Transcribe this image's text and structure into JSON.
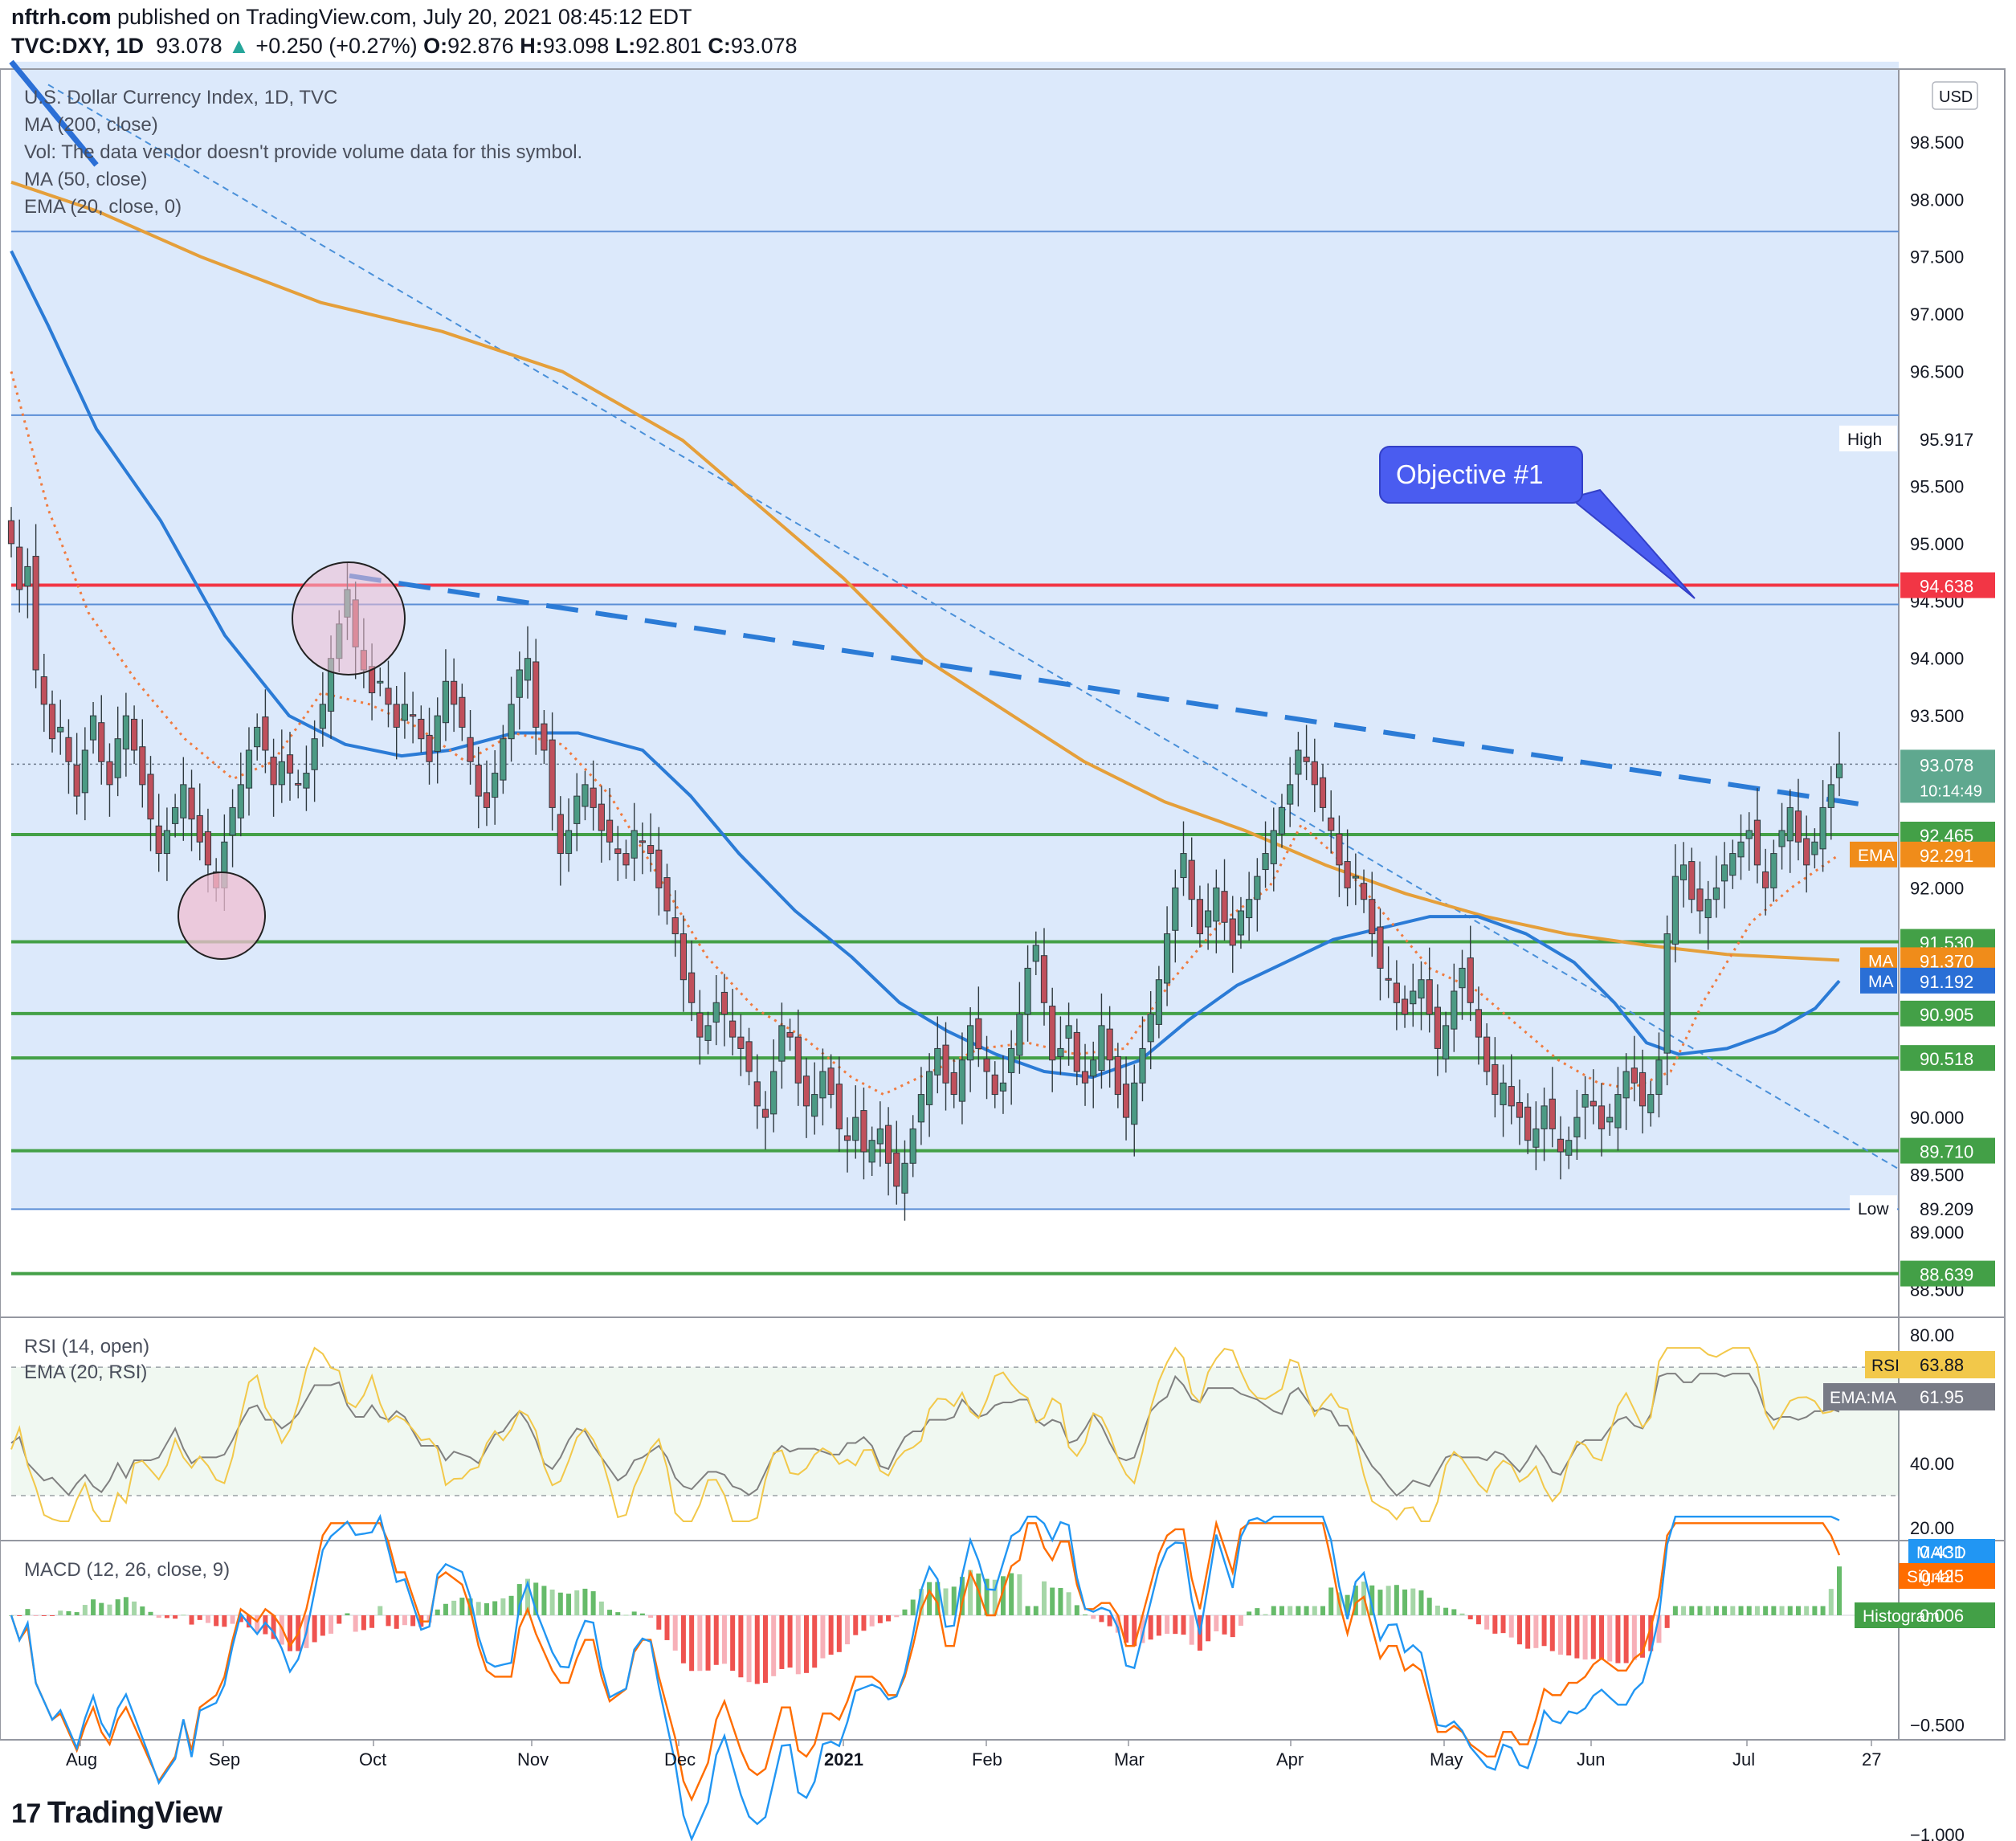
{
  "header": {
    "published_by": "nftrh.com",
    "published_rest": "published on TradingView.com, July 20, 2021 08:45:12 EDT",
    "symbol": "TVC:DXY, 1D",
    "last": "93.078",
    "change": "+0.250 (+0.27%)",
    "o_label": "O:",
    "o": "92.876",
    "h_label": "H:",
    "h": "93.098",
    "l_label": "L:",
    "l": "92.801",
    "c_label": "C:",
    "c": "93.078"
  },
  "legend": [
    "U.S. Dollar Currency Index, 1D, TVC",
    "MA (200, close)",
    "Vol: The data vendor doesn't provide volume data for this symbol.",
    "MA (50, close)",
    "EMA (20, close, 0)"
  ],
  "currency_badge": "USD",
  "annotation": "Objective #1",
  "footer": {
    "logo_mark": "17",
    "logo_text": "TradingView"
  },
  "colors": {
    "band_fill": "#dce9fb",
    "ma200": "#e59f3a",
    "ma50": "#2b7bd6",
    "ema20": "#f07b3f",
    "red_line": "#f23645",
    "green_line": "#43a047",
    "up_candle": "#4c9a84",
    "down_candle": "#c0505c",
    "rsi": "#f2c84a",
    "rsi_ema": "#808080",
    "macd": "#2196f3",
    "signal": "#ff6d00",
    "callout": "#4a5cf0"
  },
  "chart_data": [
    {
      "type": "candlestick",
      "title": "U.S. Dollar Currency Index, 1D, TVC",
      "x_ticks": [
        "Aug",
        "Sep",
        "Oct",
        "Nov",
        "Dec",
        "2021",
        "Feb",
        "Mar",
        "Apr",
        "May",
        "Jun",
        "Jul",
        "27"
      ],
      "ylim": [
        88.3,
        99.2
      ],
      "y_ticks": [
        "98.500",
        "98.000",
        "97.500",
        "97.000",
        "96.500",
        "95.500",
        "95.000",
        "94.500",
        "94.000",
        "93.500",
        "92.000",
        "90.000",
        "89.500",
        "89.000",
        "88.500"
      ],
      "closes": [
        95.0,
        94.6,
        94.8,
        93.9,
        93.6,
        93.3,
        93.4,
        93.1,
        92.8,
        93.2,
        93.5,
        93.1,
        92.9,
        93.3,
        93.5,
        93.2,
        92.9,
        92.6,
        92.3,
        92.5,
        92.7,
        92.9,
        92.6,
        92.4,
        92.2,
        92.0,
        92.4,
        92.7,
        92.9,
        93.2,
        93.4,
        93.2,
        92.9,
        93.1,
        93.0,
        92.9,
        93.0,
        93.3,
        93.6,
        94.0,
        94.3,
        94.6,
        94.1,
        93.9,
        93.7,
        93.8,
        93.6,
        93.4,
        93.6,
        93.5,
        93.3,
        93.1,
        93.5,
        93.8,
        93.6,
        93.4,
        93.1,
        92.8,
        92.7,
        93.0,
        93.3,
        93.6,
        93.9,
        94.0,
        93.4,
        93.2,
        92.7,
        92.3,
        92.5,
        92.8,
        92.9,
        92.7,
        92.5,
        92.4,
        92.3,
        92.2,
        92.5,
        92.4,
        92.3,
        92.0,
        91.8,
        91.6,
        91.2,
        91.0,
        90.7,
        90.8,
        91.0,
        90.9,
        90.7,
        90.6,
        90.4,
        90.1,
        90.0,
        90.4,
        90.8,
        90.7,
        90.3,
        90.1,
        90.2,
        90.4,
        90.2,
        89.9,
        89.8,
        90.0,
        89.7,
        89.8,
        89.9,
        89.6,
        89.4,
        89.6,
        89.9,
        90.2,
        90.4,
        90.6,
        90.3,
        90.2,
        90.5,
        90.8,
        90.6,
        90.4,
        90.2,
        90.3,
        90.6,
        90.9,
        91.3,
        91.5,
        91.0,
        90.5,
        90.6,
        90.8,
        90.4,
        90.3,
        90.5,
        90.8,
        90.5,
        90.2,
        90.0,
        90.3,
        90.6,
        90.9,
        91.2,
        91.6,
        92.0,
        92.3,
        91.9,
        91.6,
        91.8,
        92.0,
        91.7,
        91.5,
        91.8,
        91.9,
        92.1,
        92.3,
        92.5,
        92.7,
        92.9,
        93.2,
        93.1,
        92.9,
        92.7,
        92.5,
        92.2,
        92.0,
        92.1,
        91.9,
        91.6,
        91.3,
        91.2,
        91.0,
        90.9,
        91.1,
        91.2,
        90.9,
        90.6,
        90.8,
        91.1,
        91.3,
        91.0,
        90.7,
        90.4,
        90.2,
        90.3,
        90.1,
        90.0,
        89.8,
        89.9,
        90.1,
        89.9,
        89.7,
        89.8,
        90.0,
        90.2,
        90.1,
        89.9,
        90.0,
        90.2,
        90.4,
        90.3,
        90.1,
        90.2,
        90.5,
        91.6,
        92.1,
        92.2,
        91.9,
        91.8,
        91.9,
        92.0,
        92.2,
        92.3,
        92.4,
        92.5,
        92.2,
        92.0,
        92.3,
        92.5,
        92.7,
        92.4,
        92.2,
        92.4,
        92.7,
        92.9,
        93.08
      ]
    },
    {
      "type": "line",
      "title": "RSI (14, open)",
      "series": [
        {
          "name": "RSI (14, open)",
          "last_value": "63.88"
        },
        {
          "name": "EMA (20, RSI)",
          "last_value": "61.95"
        }
      ],
      "y_ticks": [
        "80.00",
        "40.00",
        "20.00"
      ],
      "ylim": [
        10,
        82
      ]
    },
    {
      "type": "line",
      "title": "MACD (12, 26, close, 9)",
      "series": [
        {
          "name": "MACD",
          "last_value": "0.431"
        },
        {
          "name": "Signal",
          "last_value": "0.425"
        },
        {
          "name": "Histogram",
          "last_value": "0.006"
        }
      ],
      "y_ticks": [
        "−0.500",
        "−1.000"
      ],
      "ylim": [
        -1.15,
        0.55
      ]
    }
  ],
  "price_labels": [
    {
      "text": "High",
      "value": "95.917",
      "price": 95.917
    },
    {
      "text": "",
      "value": "94.638",
      "price": 94.638
    },
    {
      "text": "",
      "value": "93.078",
      "price": 93.078,
      "sub": "10:14:49"
    },
    {
      "text": "",
      "value": "92.465",
      "price": 92.465
    },
    {
      "text": "EMA",
      "value": "92.291",
      "price": 92.291
    },
    {
      "text": "",
      "value": "91.530",
      "price": 91.53
    },
    {
      "text": "MA",
      "value": "91.370",
      "price": 91.37
    },
    {
      "text": "MA",
      "value": "91.192",
      "price": 91.192
    },
    {
      "text": "",
      "value": "90.905",
      "price": 90.905
    },
    {
      "text": "",
      "value": "90.518",
      "price": 90.518
    },
    {
      "text": "",
      "value": "89.710",
      "price": 89.71
    },
    {
      "text": "Low",
      "value": "89.209",
      "price": 89.209
    },
    {
      "text": "",
      "value": "88.639",
      "price": 88.639
    }
  ],
  "levels": {
    "red": 94.638,
    "green": [
      92.465,
      91.53,
      90.905,
      90.518,
      89.71,
      88.639
    ],
    "blue": [
      97.72,
      96.12,
      94.47,
      89.2
    ]
  },
  "rsi_labels": [
    {
      "text": "RSI",
      "value": "63.88"
    },
    {
      "text": "EMA:MA",
      "value": "61.95"
    }
  ],
  "macd_labels": [
    {
      "text": "MACD",
      "value": "0.431"
    },
    {
      "text": "Signal",
      "value": "0.425"
    },
    {
      "text": "Histogram",
      "value": "0.006"
    }
  ]
}
